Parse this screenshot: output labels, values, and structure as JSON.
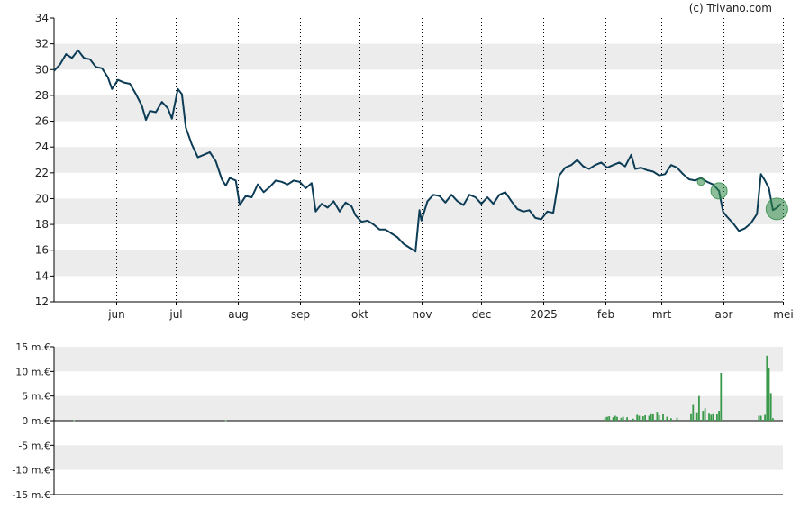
{
  "credit": "(c) Trivano.com",
  "colors": {
    "price_line": "#0d3d56",
    "volume_bar": "#3a9a4a",
    "band": "#ececec",
    "bubble": "#2e8b45"
  },
  "chart_data": [
    {
      "type": "line",
      "y_range": [
        12,
        34
      ],
      "y_ticks": [
        "12",
        "14",
        "16",
        "18",
        "20",
        "22",
        "24",
        "26",
        "28",
        "30",
        "32",
        "34"
      ],
      "x_range": [
        "2024-05-01",
        "2025-05-01"
      ],
      "x_tick_labels": [
        {
          "label": "jun",
          "date": "2024-06-01"
        },
        {
          "label": "jul",
          "date": "2024-07-01"
        },
        {
          "label": "aug",
          "date": "2024-08-01"
        },
        {
          "label": "sep",
          "date": "2024-09-01"
        },
        {
          "label": "okt",
          "date": "2024-10-01"
        },
        {
          "label": "nov",
          "date": "2024-11-01"
        },
        {
          "label": "dec",
          "date": "2024-12-01"
        },
        {
          "label": "2025",
          "date": "2025-01-01"
        },
        {
          "label": "feb",
          "date": "2025-02-01"
        },
        {
          "label": "mrt",
          "date": "2025-03-01"
        },
        {
          "label": "apr",
          "date": "2025-04-01"
        },
        {
          "label": "mei",
          "date": "2025-05-01"
        }
      ],
      "grid": "vertical dotted lines at month boundaries, alternating horizontal bands",
      "series": [
        {
          "points": [
            [
              "2024-05-01",
              29.9
            ],
            [
              "2024-05-04",
              30.4
            ],
            [
              "2024-05-07",
              31.2
            ],
            [
              "2024-05-10",
              30.9
            ],
            [
              "2024-05-13",
              31.5
            ],
            [
              "2024-05-16",
              30.9
            ],
            [
              "2024-05-19",
              30.8
            ],
            [
              "2024-05-22",
              30.2
            ],
            [
              "2024-05-25",
              30.1
            ],
            [
              "2024-05-28",
              29.4
            ],
            [
              "2024-05-30",
              28.5
            ],
            [
              "2024-06-02",
              29.2
            ],
            [
              "2024-06-05",
              29.0
            ],
            [
              "2024-06-08",
              28.9
            ],
            [
              "2024-06-11",
              28.1
            ],
            [
              "2024-06-14",
              27.2
            ],
            [
              "2024-06-16",
              26.1
            ],
            [
              "2024-06-18",
              26.8
            ],
            [
              "2024-06-21",
              26.7
            ],
            [
              "2024-06-24",
              27.5
            ],
            [
              "2024-06-27",
              27.0
            ],
            [
              "2024-06-29",
              26.2
            ],
            [
              "2024-07-02",
              28.5
            ],
            [
              "2024-07-04",
              28.1
            ],
            [
              "2024-07-06",
              25.5
            ],
            [
              "2024-07-09",
              24.2
            ],
            [
              "2024-07-12",
              23.2
            ],
            [
              "2024-07-15",
              23.4
            ],
            [
              "2024-07-18",
              23.6
            ],
            [
              "2024-07-21",
              22.9
            ],
            [
              "2024-07-24",
              21.5
            ],
            [
              "2024-07-26",
              21.0
            ],
            [
              "2024-07-28",
              21.6
            ],
            [
              "2024-07-31",
              21.4
            ],
            [
              "2024-08-02",
              19.5
            ],
            [
              "2024-08-05",
              20.2
            ],
            [
              "2024-08-08",
              20.1
            ],
            [
              "2024-08-11",
              21.1
            ],
            [
              "2024-08-14",
              20.5
            ],
            [
              "2024-08-17",
              20.9
            ],
            [
              "2024-08-20",
              21.4
            ],
            [
              "2024-08-23",
              21.3
            ],
            [
              "2024-08-26",
              21.1
            ],
            [
              "2024-08-29",
              21.4
            ],
            [
              "2024-09-01",
              21.3
            ],
            [
              "2024-09-04",
              20.8
            ],
            [
              "2024-09-07",
              21.2
            ],
            [
              "2024-09-09",
              19.0
            ],
            [
              "2024-09-12",
              19.6
            ],
            [
              "2024-09-15",
              19.3
            ],
            [
              "2024-09-18",
              19.8
            ],
            [
              "2024-09-21",
              19.0
            ],
            [
              "2024-09-24",
              19.7
            ],
            [
              "2024-09-27",
              19.4
            ],
            [
              "2024-09-29",
              18.7
            ],
            [
              "2024-10-02",
              18.2
            ],
            [
              "2024-10-05",
              18.3
            ],
            [
              "2024-10-08",
              18.0
            ],
            [
              "2024-10-11",
              17.6
            ],
            [
              "2024-10-14",
              17.6
            ],
            [
              "2024-10-17",
              17.3
            ],
            [
              "2024-10-20",
              17.0
            ],
            [
              "2024-10-23",
              16.5
            ],
            [
              "2024-10-26",
              16.2
            ],
            [
              "2024-10-29",
              15.9
            ],
            [
              "2024-10-31",
              19.1
            ],
            [
              "2024-11-01",
              18.3
            ],
            [
              "2024-11-04",
              19.8
            ],
            [
              "2024-11-07",
              20.3
            ],
            [
              "2024-11-10",
              20.2
            ],
            [
              "2024-11-13",
              19.7
            ],
            [
              "2024-11-16",
              20.3
            ],
            [
              "2024-11-19",
              19.8
            ],
            [
              "2024-11-22",
              19.5
            ],
            [
              "2024-11-25",
              20.3
            ],
            [
              "2024-11-28",
              20.1
            ],
            [
              "2024-12-01",
              19.6
            ],
            [
              "2024-12-04",
              20.1
            ],
            [
              "2024-12-07",
              19.6
            ],
            [
              "2024-12-10",
              20.3
            ],
            [
              "2024-12-13",
              20.5
            ],
            [
              "2024-12-16",
              19.8
            ],
            [
              "2024-12-19",
              19.2
            ],
            [
              "2024-12-22",
              19.0
            ],
            [
              "2024-12-25",
              19.1
            ],
            [
              "2024-12-28",
              18.5
            ],
            [
              "2024-12-31",
              18.4
            ],
            [
              "2025-01-03",
              19.0
            ],
            [
              "2025-01-06",
              18.9
            ],
            [
              "2025-01-09",
              21.8
            ],
            [
              "2025-01-12",
              22.4
            ],
            [
              "2025-01-15",
              22.6
            ],
            [
              "2025-01-18",
              23.0
            ],
            [
              "2025-01-21",
              22.5
            ],
            [
              "2025-01-24",
              22.3
            ],
            [
              "2025-01-27",
              22.6
            ],
            [
              "2025-01-30",
              22.8
            ],
            [
              "2025-02-02",
              22.4
            ],
            [
              "2025-02-05",
              22.6
            ],
            [
              "2025-02-08",
              22.8
            ],
            [
              "2025-02-11",
              22.5
            ],
            [
              "2025-02-14",
              23.4
            ],
            [
              "2025-02-16",
              22.3
            ],
            [
              "2025-02-19",
              22.4
            ],
            [
              "2025-02-22",
              22.2
            ],
            [
              "2025-02-25",
              22.1
            ],
            [
              "2025-02-28",
              21.8
            ],
            [
              "2025-03-03",
              21.9
            ],
            [
              "2025-03-06",
              22.6
            ],
            [
              "2025-03-09",
              22.4
            ],
            [
              "2025-03-12",
              21.9
            ],
            [
              "2025-03-15",
              21.5
            ],
            [
              "2025-03-18",
              21.4
            ],
            [
              "2025-03-21",
              21.6
            ],
            [
              "2025-03-24",
              21.3
            ],
            [
              "2025-03-27",
              21.1
            ],
            [
              "2025-03-30",
              20.6
            ],
            [
              "2025-04-01",
              19.0
            ],
            [
              "2025-04-03",
              18.6
            ],
            [
              "2025-04-06",
              18.1
            ],
            [
              "2025-04-09",
              17.5
            ],
            [
              "2025-04-12",
              17.7
            ],
            [
              "2025-04-15",
              18.1
            ],
            [
              "2025-04-18",
              18.8
            ],
            [
              "2025-04-20",
              21.9
            ],
            [
              "2025-04-22",
              21.4
            ],
            [
              "2025-04-24",
              20.8
            ],
            [
              "2025-04-26",
              19.1
            ],
            [
              "2025-04-28",
              19.3
            ],
            [
              "2025-04-30",
              19.6
            ]
          ]
        }
      ],
      "markers": [
        {
          "date": "2025-03-21",
          "value": 21.3,
          "size": "small"
        },
        {
          "date": "2025-03-30",
          "value": 20.6,
          "size": "medium"
        },
        {
          "date": "2025-04-28",
          "value": 19.2,
          "size": "large"
        }
      ]
    },
    {
      "type": "bar",
      "unit": "m.€",
      "y_range": [
        -15,
        15
      ],
      "y_ticks": [
        "15 m.€",
        "10 m.€",
        "5 m.€",
        "0 m.€",
        "-5 m.€",
        "-10 m.€",
        "-15 m.€"
      ],
      "x_range": [
        "2024-05-01",
        "2025-05-01"
      ],
      "series": [
        {
          "bars": [
            [
              "2024-05-11",
              0.1
            ],
            [
              "2024-07-26",
              0.1
            ],
            [
              "2025-02-01",
              0.7
            ],
            [
              "2025-02-02",
              0.8
            ],
            [
              "2025-02-03",
              0.9
            ],
            [
              "2025-02-05",
              0.7
            ],
            [
              "2025-02-06",
              1.0
            ],
            [
              "2025-02-07",
              0.8
            ],
            [
              "2025-02-09",
              0.6
            ],
            [
              "2025-02-10",
              0.8
            ],
            [
              "2025-02-12",
              0.7
            ],
            [
              "2025-02-15",
              0.4
            ],
            [
              "2025-02-17",
              1.2
            ],
            [
              "2025-02-18",
              1.0
            ],
            [
              "2025-02-20",
              0.9
            ],
            [
              "2025-02-21",
              1.1
            ],
            [
              "2025-02-23",
              1.0
            ],
            [
              "2025-02-24",
              1.5
            ],
            [
              "2025-02-25",
              1.3
            ],
            [
              "2025-02-27",
              1.8
            ],
            [
              "2025-02-28",
              1.1
            ],
            [
              "2025-03-02",
              1.4
            ],
            [
              "2025-03-04",
              0.8
            ],
            [
              "2025-03-06",
              0.5
            ],
            [
              "2025-03-09",
              0.6
            ],
            [
              "2025-03-16",
              1.5
            ],
            [
              "2025-03-17",
              3.2
            ],
            [
              "2025-03-19",
              1.7
            ],
            [
              "2025-03-20",
              5.0
            ],
            [
              "2025-03-22",
              2.0
            ],
            [
              "2025-03-23",
              2.5
            ],
            [
              "2025-03-25",
              1.6
            ],
            [
              "2025-03-26",
              1.2
            ],
            [
              "2025-03-27",
              1.5
            ],
            [
              "2025-03-29",
              1.4
            ],
            [
              "2025-03-30",
              2.0
            ],
            [
              "2025-03-31",
              9.7
            ],
            [
              "2025-04-19",
              1.0
            ],
            [
              "2025-04-20",
              1.0
            ],
            [
              "2025-04-22",
              1.2
            ],
            [
              "2025-04-23",
              13.2
            ],
            [
              "2025-04-24",
              10.7
            ],
            [
              "2025-04-25",
              5.6
            ],
            [
              "2025-04-26",
              0.5
            ]
          ]
        }
      ]
    }
  ]
}
